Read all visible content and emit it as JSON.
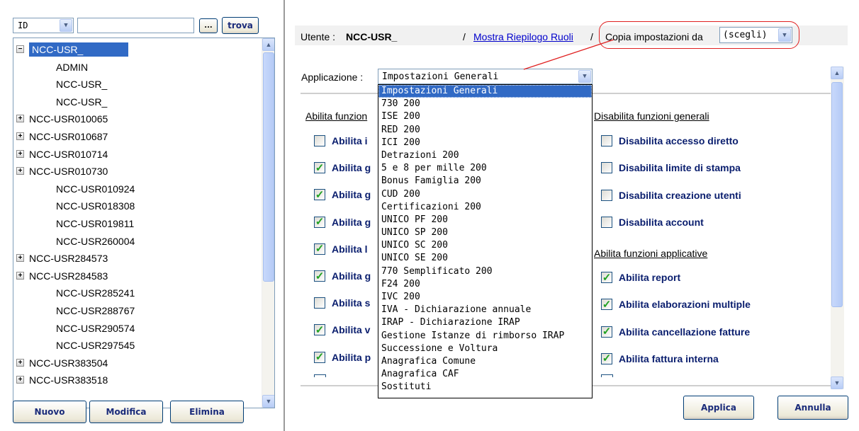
{
  "search": {
    "field_select_value": "ID",
    "search_value": "",
    "ellipsis_label": "...",
    "find_label": "trova"
  },
  "tree": {
    "root_label": "NCC-USR_",
    "items": [
      {
        "label": "ADMIN",
        "expandable": false
      },
      {
        "label": "NCC-USR_",
        "expandable": false
      },
      {
        "label": "NCC-USR_",
        "expandable": false
      },
      {
        "label": "NCC-USR010065",
        "expandable": true
      },
      {
        "label": "NCC-USR010687",
        "expandable": true
      },
      {
        "label": "NCC-USR010714",
        "expandable": true
      },
      {
        "label": "NCC-USR010730",
        "expandable": true
      },
      {
        "label": "NCC-USR010924",
        "expandable": false
      },
      {
        "label": "NCC-USR018308",
        "expandable": false
      },
      {
        "label": "NCC-USR019811",
        "expandable": false
      },
      {
        "label": "NCC-USR260004",
        "expandable": false
      },
      {
        "label": "NCC-USR284573",
        "expandable": true
      },
      {
        "label": "NCC-USR284583",
        "expandable": true
      },
      {
        "label": "NCC-USR285241",
        "expandable": false
      },
      {
        "label": "NCC-USR288767",
        "expandable": false
      },
      {
        "label": "NCC-USR290574",
        "expandable": false
      },
      {
        "label": "NCC-USR297545",
        "expandable": false
      },
      {
        "label": "NCC-USR383504",
        "expandable": true
      },
      {
        "label": "NCC-USR383518",
        "expandable": true
      }
    ]
  },
  "left_buttons": {
    "new_label": "Nuovo",
    "edit_label": "Modifica",
    "delete_label": "Elimina"
  },
  "header": {
    "user_prefix": "Utente :",
    "user_name": "NCC-USR_",
    "separator1": "/",
    "roles_link": "Mostra Riepilogo Ruoli",
    "separator2": "/",
    "copy_label": "Copia impostazioni da",
    "copy_select_value": "(scegli)"
  },
  "application": {
    "label": "Applicazione :",
    "selected": "Impostazioni Generali",
    "options": [
      "Impostazioni Generali",
      "730 200",
      "ISE 200",
      "RED 200",
      "ICI 200",
      "Detrazioni 200",
      "5 e 8 per mille 200",
      "Bonus Famiglia 200",
      "CUD 200",
      "Certificazioni 200",
      "UNICO PF 200",
      "UNICO SP 200",
      "UNICO SC 200",
      "UNICO SE 200",
      "770 Semplificato 200",
      "F24 200",
      "IVC 200",
      "IVA - Dichiarazione annuale",
      "IRAP - Dichiarazione IRAP",
      "Gestione Istanze di rimborso IRAP",
      "Successione e Voltura",
      "Anagrafica Comune",
      "Anagrafica CAF",
      "Sostituti"
    ]
  },
  "sections": {
    "enable_general_title": "Abilita funzion",
    "disable_general_title": "Disabilita funzioni generali",
    "enable_app_title": "Abilita funzioni applicative"
  },
  "left_checks": [
    {
      "label": "Abilita i",
      "checked": false
    },
    {
      "label": "Abilita g",
      "checked": true
    },
    {
      "label": "Abilita g",
      "checked": true
    },
    {
      "label": "Abilita g",
      "checked": true
    },
    {
      "label": "Abilita l",
      "checked": true
    },
    {
      "label": "Abilita g",
      "checked": true
    },
    {
      "label": "Abilita s",
      "checked": false
    },
    {
      "label": "Abilita v",
      "checked": true
    },
    {
      "label": "Abilita p",
      "checked": true
    }
  ],
  "disable_checks": [
    {
      "label": "Disabilita accesso diretto",
      "checked": false
    },
    {
      "label": "Disabilita limite di stampa",
      "checked": false
    },
    {
      "label": "Disabilita creazione utenti",
      "checked": false
    },
    {
      "label": "Disabilita account",
      "checked": false
    }
  ],
  "app_checks": [
    {
      "label": "Abilita report",
      "checked": true
    },
    {
      "label": "Abilita elaborazioni multiple",
      "checked": true
    },
    {
      "label": "Abilita cancellazione fatture",
      "checked": true
    },
    {
      "label": "Abilita fattura interna",
      "checked": true
    }
  ],
  "actions": {
    "apply_label": "Applica",
    "cancel_label": "Annulla"
  },
  "icons": {
    "dropdown": "chevron-down-icon",
    "expand": "plus-icon",
    "collapse": "minus-icon",
    "check": "checkmark-icon"
  },
  "colors": {
    "selection": "#316ac5",
    "link": "#0000cc",
    "label_bold": "#0a1e6e",
    "annotation": "#e02020",
    "check_mark": "#21a121"
  }
}
